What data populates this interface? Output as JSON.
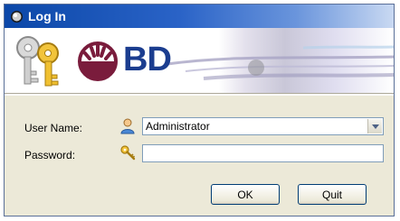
{
  "window": {
    "title": "Log In",
    "title_icon": "app-icon",
    "brand_text": "BD",
    "brand_color": "#1b3d8f"
  },
  "form": {
    "username_label": "User Name:",
    "username_value": "Administrator",
    "username_icon": "user-icon",
    "password_label": "Password:",
    "password_value": "",
    "password_icon": "key-icon"
  },
  "buttons": {
    "ok_label": "OK",
    "quit_label": "Quit"
  }
}
